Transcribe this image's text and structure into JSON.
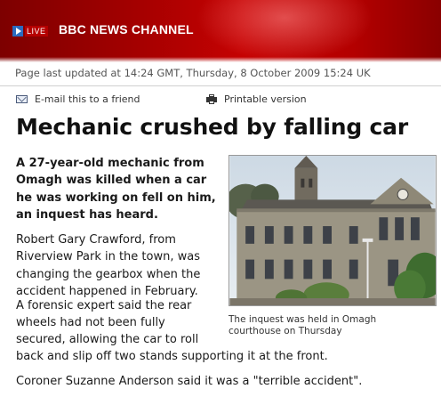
{
  "header": {
    "live_label": "LIVE",
    "channel_title": "BBC NEWS CHANNEL"
  },
  "meta": {
    "updated_text": "Page last updated at 14:24 GMT, Thursday, 8 October 2009 15:24 UK"
  },
  "tools": {
    "email_label": "E-mail this to a friend",
    "print_label": "Printable version"
  },
  "article": {
    "headline": "Mechanic crushed by falling car",
    "intro": "A 27-year-old mechanic from Omagh was killed when a car he was working on fell on him, an inquest has heard.",
    "para1": "Robert Gary Crawford, from Riverview Park in the town, was changing the gearbox when the accident happened in February.",
    "para2_lines": [
      "A forensic expert said the rear",
      "wheels had not been fully",
      "secured, allowing the car to roll",
      "back and slip off two stands supporting it at the front."
    ],
    "para3": "Coroner Suzanne Anderson said it was a \"terrible accident\"."
  },
  "image": {
    "caption": "The inquest was held in Omagh courthouse on Thursday"
  },
  "colors": {
    "banner_red": "#c50202",
    "live_blue": "#2b6bbf"
  }
}
